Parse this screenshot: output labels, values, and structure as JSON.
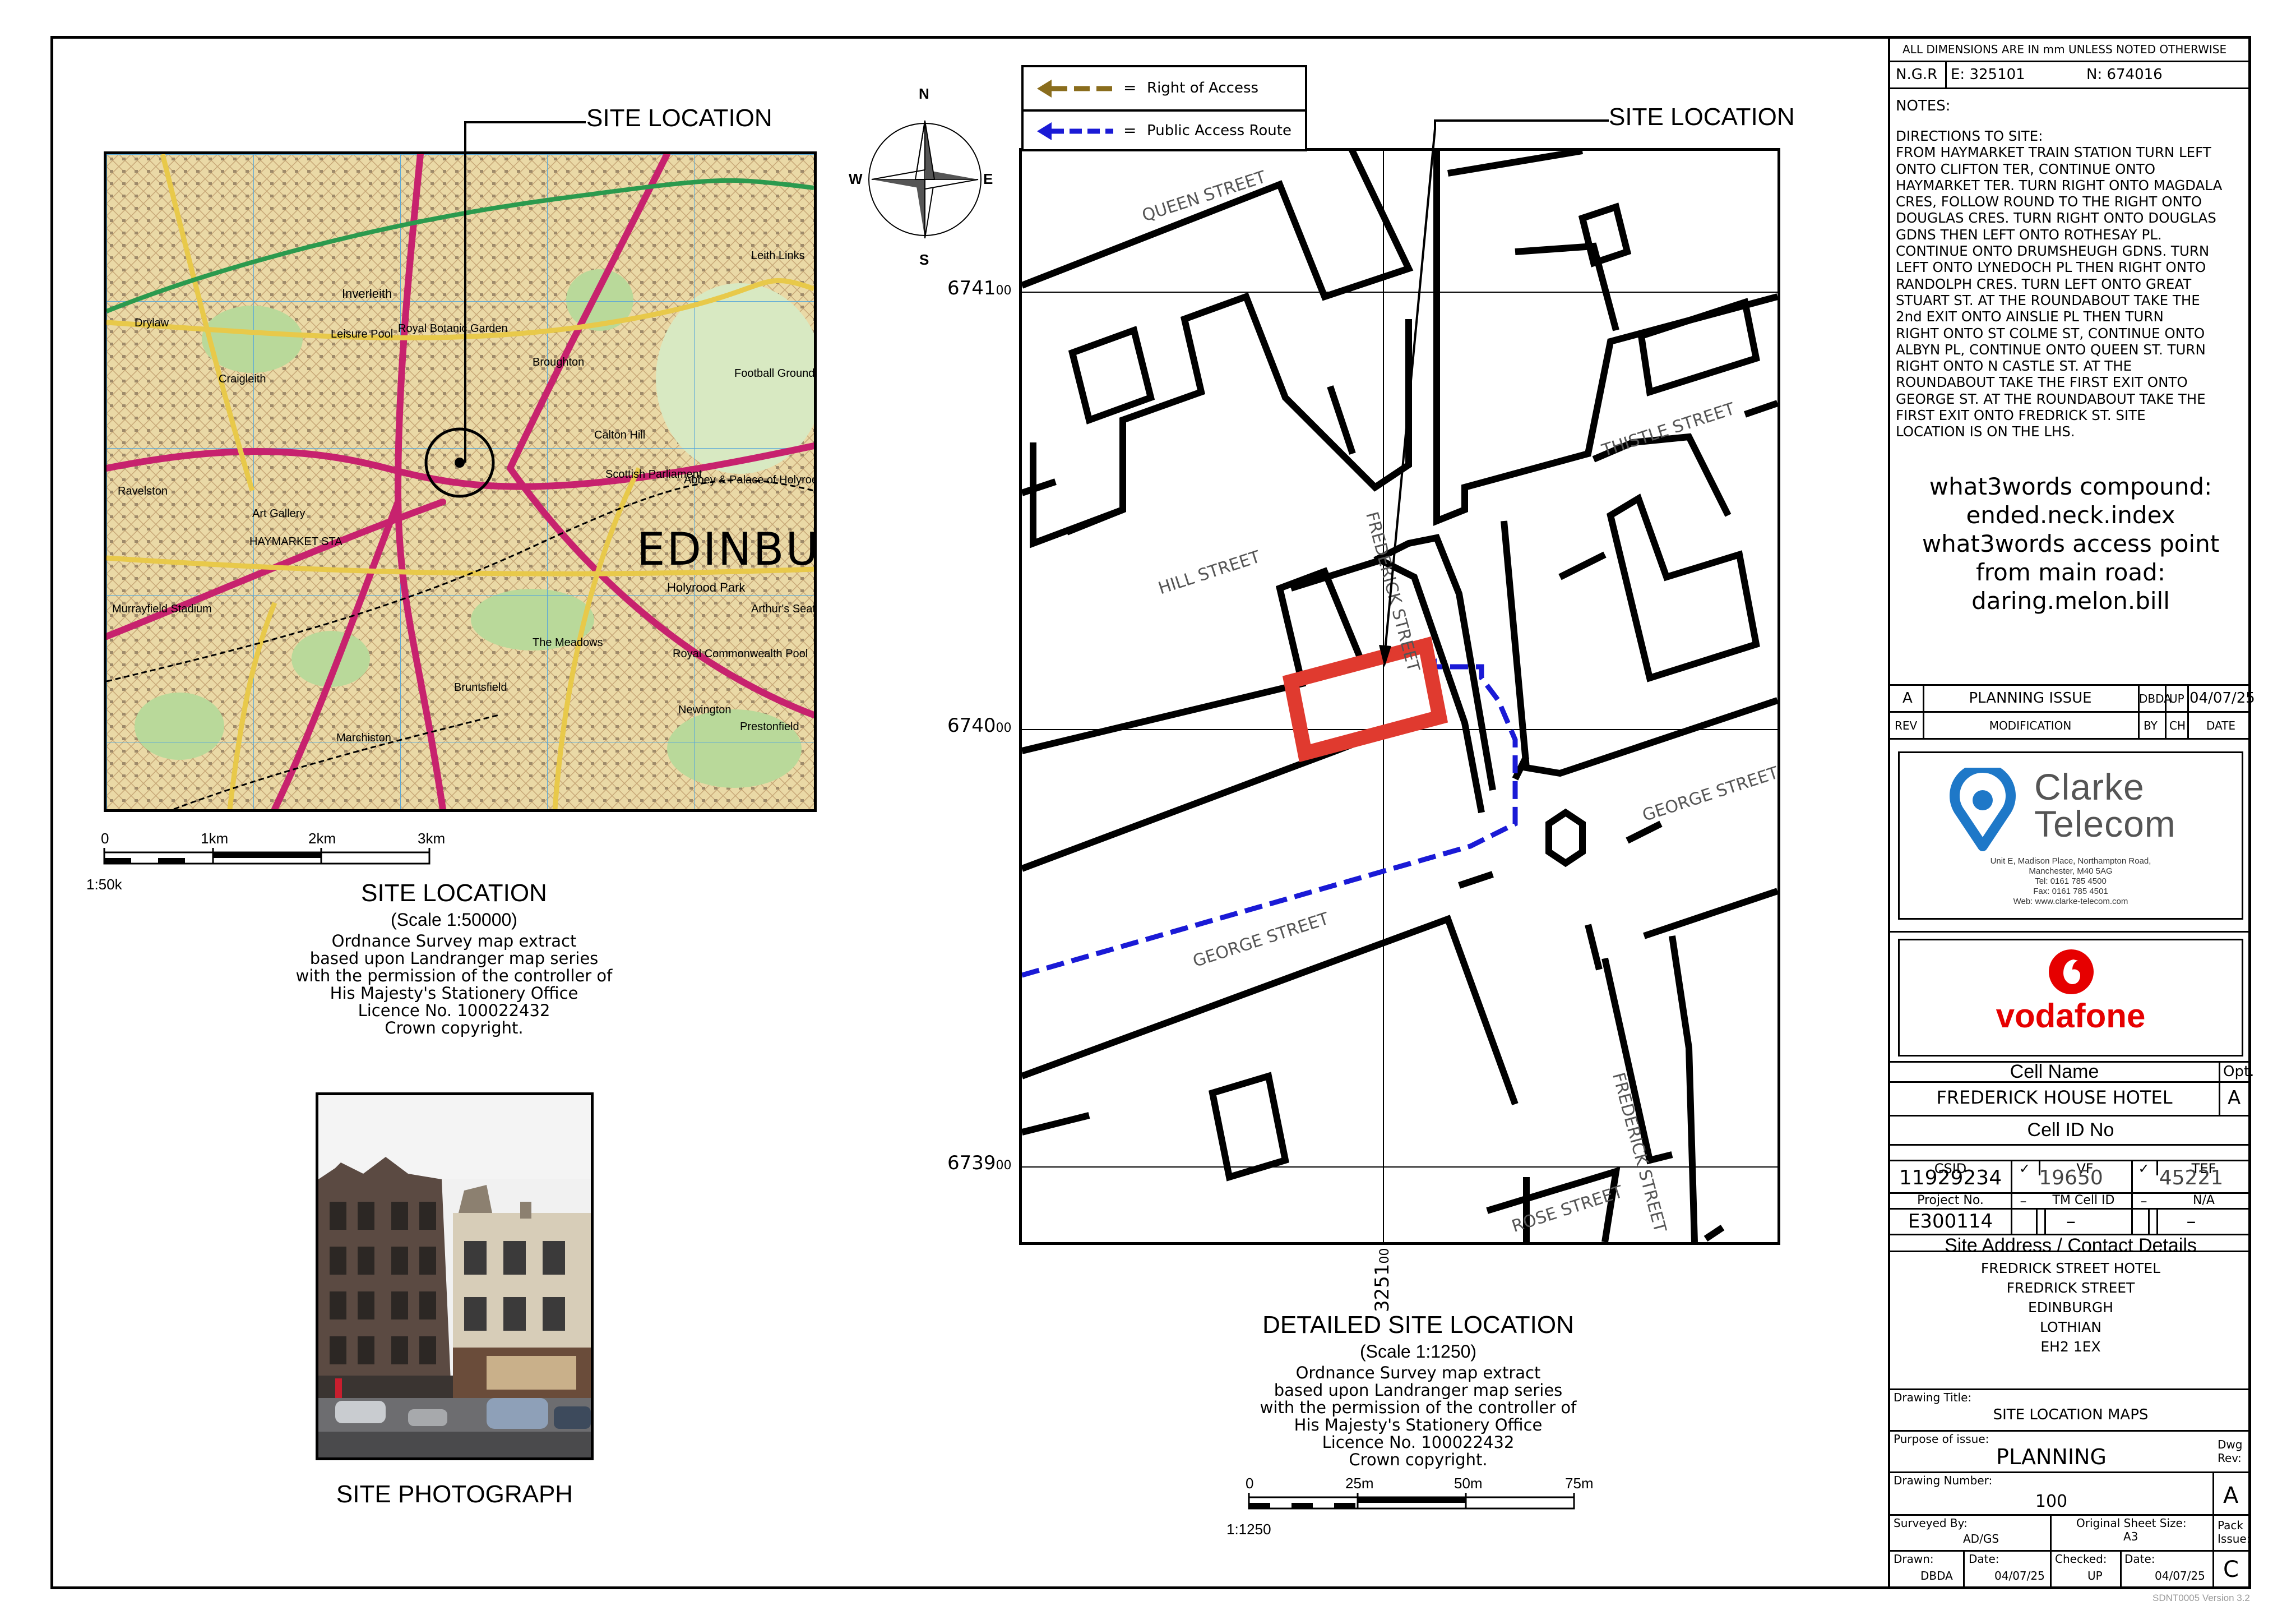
{
  "site_location_label": "SITE  LOCATION",
  "overview_map": {
    "place_label": "EDINBU",
    "scale_ticks": [
      "0",
      "1km",
      "2km",
      "3km"
    ],
    "scale_ratio": "1:50k",
    "title": "SITE LOCATION",
    "scale": "(Scale 1:50000)",
    "credit_lines": [
      "Ordnance Survey map extract",
      "based upon Landranger map series",
      "with the permission of the controller of",
      "His Majesty's Stationery Office",
      "Licence No. 100022432",
      "Crown copyright."
    ],
    "labels": [
      "Inverleith",
      "Royal Botanic Garden",
      "Leisure Pool",
      "Art Gallery",
      "HAYMARKET STA",
      "Murrayfield Stadium",
      "Ravelston",
      "Holyrood Park",
      "Arthur's Seat",
      "The Meadows",
      "Bruntsfield",
      "Marchiston",
      "Royal Commonwealth Pool",
      "Abbey & Palace of Holyroodhouse",
      "Scottish Parliament",
      "Calton Hill",
      "Broughton",
      "Newington",
      "Prestonfield",
      "Football Ground",
      "Craigleith",
      "Drylaw",
      "Leith Links"
    ]
  },
  "photo": {
    "caption": "SITE PHOTOGRAPH"
  },
  "compass": {
    "n": "N",
    "s": "S",
    "e": "E",
    "w": "W"
  },
  "legend": {
    "items": [
      {
        "label": "Right  of  Access",
        "color": "#8a6d1d"
      },
      {
        "label": "Public  Access  Route",
        "color": "#1a1ad6"
      }
    ],
    "eq": "="
  },
  "detail_map": {
    "streets": [
      "QUEEN STREET",
      "THISTLE STREET",
      "HILL STREET",
      "FREDERICK STREET",
      "GEORGE STREET",
      "GEORGE STREET",
      "FREDERICK STREET",
      "ROSE STREET"
    ],
    "northings": [
      {
        "main": "6741",
        "sub": "00"
      },
      {
        "main": "6740",
        "sub": "00"
      },
      {
        "main": "6739",
        "sub": "00"
      }
    ],
    "easting": {
      "main": "3251",
      "sub": "00"
    },
    "site_color": "#e03a2f",
    "title": "DETAILED SITE LOCATION",
    "scale": "(Scale 1:1250)",
    "credit_lines": [
      "Ordnance Survey map extract",
      "based upon Landranger map series",
      "with the permission of the controller of",
      "His Majesty's Stationery Office",
      "Licence No. 100022432",
      "Crown copyright."
    ],
    "scale_ticks": [
      "0",
      "25m",
      "50m",
      "75m"
    ],
    "scale_ratio": "1:1250"
  },
  "title_block": {
    "dims_note": "ALL  DIMENSIONS  ARE  IN  mm  UNLESS  NOTED  OTHERWISE",
    "ngr_label": "N.G.R",
    "easting": "E:  325101",
    "northing": "N:  674016",
    "notes_label": "NOTES:",
    "directions": [
      "DIRECTIONS  TO  SITE:",
      "FROM  HAYMARKET  TRAIN  STATION  TURN  LEFT",
      "ONTO  CLIFTON  TER,  CONTINUE  ONTO",
      "HAYMARKET  TER.  TURN  RIGHT  ONTO  MAGDALA",
      "CRES,  FOLLOW  ROUND  TO  THE  RIGHT  ONTO",
      "DOUGLAS  CRES.  TURN  RIGHT  ONTO  DOUGLAS",
      "GDNS  THEN  LEFT  ONTO  ROTHESAY  PL.",
      "CONTINUE  ONTO  DRUMSHEUGH  GDNS.  TURN",
      "LEFT  ONTO  LYNEDOCH  PL  THEN  RIGHT  ONTO",
      "RANDOLPH  CRES.  TURN  LEFT  ONTO  GREAT",
      "STUART  ST.  AT  THE  ROUNDABOUT  TAKE  THE",
      "2nd  EXIT  ONTO  AINSLIE  PL  THEN  TURN",
      "RIGHT  ONTO  ST  COLME  ST,  CONTINUE  ONTO",
      "ALBYN  PL,  CONTINUE  ONTO  QUEEN  ST.  TURN",
      "RIGHT  ONTO  N  CASTLE  ST.  AT  THE",
      "ROUNDABOUT  TAKE  THE  FIRST  EXIT  ONTO",
      "GEORGE  ST.  AT  THE  ROUNDABOUT  TAKE  THE",
      "FIRST  EXIT  ONTO  FREDRICK  ST.  SITE",
      "LOCATION  IS  ON  THE  LHS."
    ],
    "w3w": [
      "what3words  compound:",
      "ended.neck.index",
      "what3words  access  point",
      "from  main  road:",
      "daring.melon.bill"
    ],
    "rev_row": {
      "rev": "A",
      "desc": "PLANNING  ISSUE",
      "by": "DBDA",
      "ch": "UP",
      "date": "04/07/25"
    },
    "rev_header": {
      "rev": "REV",
      "desc": "MODIFICATION",
      "by": "BY",
      "ch": "CH",
      "date": "DATE"
    },
    "company": {
      "name_line1": "Clarke",
      "name_line2": "Telecom",
      "color": "#1e78c8",
      "address": [
        "Unit E, Madison Place, Northampton Road,",
        "Manchester, M40 5AG",
        "Tel: 0161 785 4500",
        "Fax: 0161 785 4501",
        "Web: www.clarke-telecom.com"
      ]
    },
    "client": {
      "name": "vodafone",
      "color": "#e60000"
    },
    "cell_name_label": "Cell Name",
    "opt_label": "Opt.",
    "cell_name": "FREDERICK  HOUSE  HOTEL",
    "opt": "A",
    "cell_id_label": "Cell ID No",
    "csid_label": "CSID",
    "vf_label": "VF",
    "tef_label": "TEF",
    "check": "✓",
    "csid": "11929234",
    "vf": "19650",
    "tef": "45221",
    "project_label": "Project No.",
    "tm_label": "TM Cell ID",
    "na_label": "N/A",
    "dash": "–",
    "project": "E300114",
    "tm_value": "–",
    "na_value": "–",
    "address_label": "Site Address / Contact Details",
    "address": [
      "FREDRICK  STREET  HOTEL",
      "FREDRICK  STREET",
      "EDINBURGH",
      "LOTHIAN",
      "EH2  1EX"
    ],
    "drawing_title_label": "Drawing Title:",
    "drawing_title": "SITE  LOCATION  MAPS",
    "purpose_label": "Purpose of issue:",
    "purpose": "PLANNING",
    "dwg_rev_label": "Dwg Rev:",
    "drawing_number_label": "Drawing Number:",
    "drawing_number": "100",
    "dwg_rev": "A",
    "surveyed_label": "Surveyed By:",
    "surveyed": "AD/GS",
    "sheet_size_label": "Original Sheet Size:",
    "sheet_size": "A3",
    "pack_label": "Pack Issue:",
    "drawn_label": "Drawn:",
    "drawn": "DBDA",
    "date_label": "Date:",
    "date": "04/07/25",
    "checked_label": "Checked:",
    "checked": "UP",
    "date2_label": "Date:",
    "date2": "04/07/25",
    "pack": "C",
    "version": "SDNT0005 Version 3.2"
  }
}
